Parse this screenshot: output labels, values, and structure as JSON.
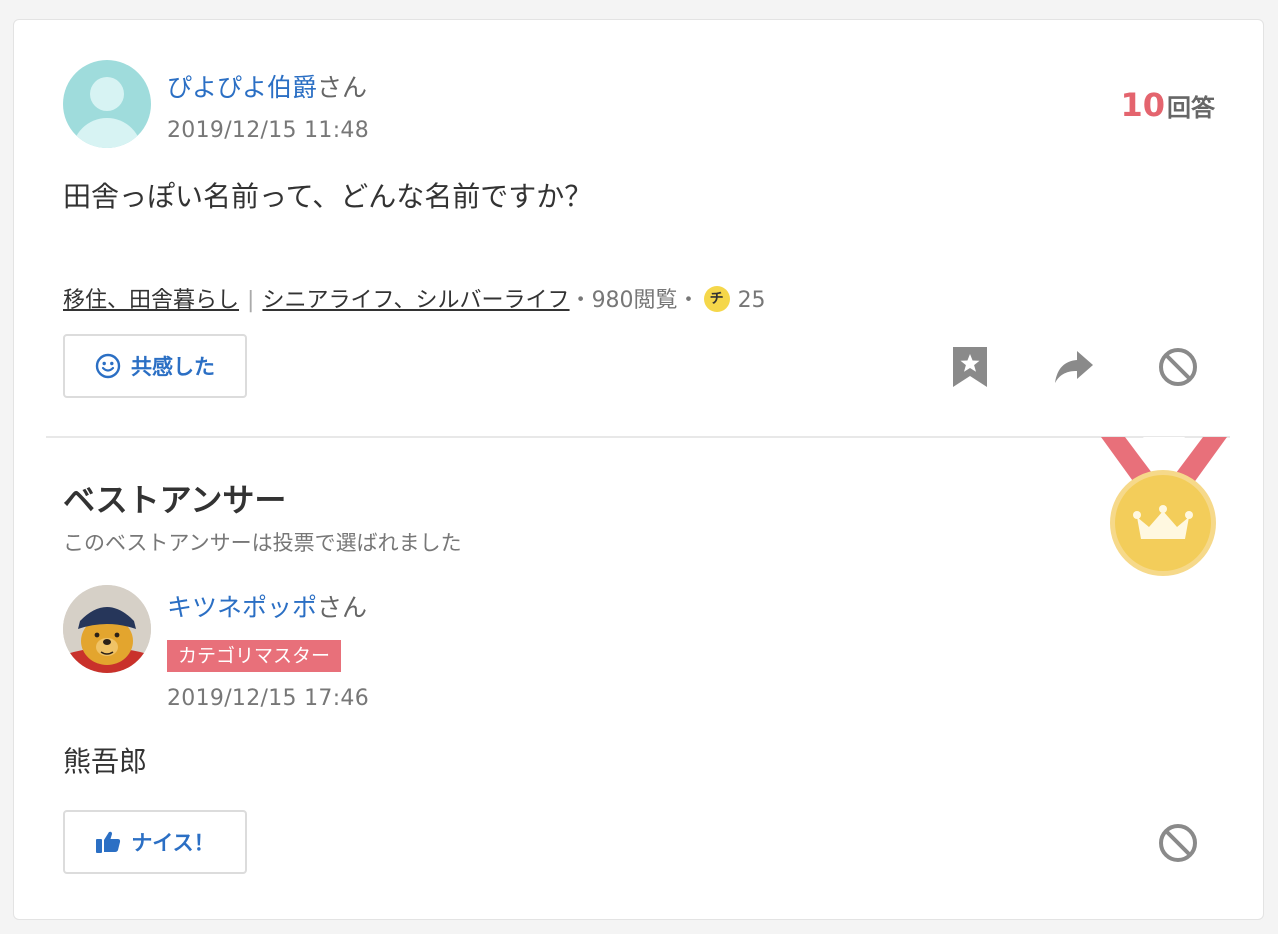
{
  "question": {
    "user_name": "ぴよぴよ伯爵",
    "user_suffix": "さん",
    "date": "2019/12/15 11:48",
    "answer_count": "10",
    "answer_count_label": "回答",
    "text": "田舎っぽい名前って、どんな名前ですか？",
    "category1": "移住、田舎暮らし",
    "category_separator": "|",
    "category2": "シニアライフ、シルバーライフ",
    "views": "・980閲覧・",
    "coin_label": "チ",
    "coins": "25",
    "empathy_button": "共感した"
  },
  "best_answer": {
    "title": "ベストアンサー",
    "subtitle": "このベストアンサーは投票で選ばれました",
    "user_name": "キツネポッポ",
    "user_suffix": "さん",
    "badge": "カテゴリマスター",
    "date": "2019/12/15 17:46",
    "text": "熊吾郎",
    "nice_button": "ナイス！"
  },
  "colors": {
    "link_blue": "#2b6fc4",
    "answer_count_red": "#e4646e",
    "badge_pink": "#e8707a",
    "medal_gold": "#f3cd5a",
    "ribbon_red": "#e8707a"
  },
  "icons": [
    "smile-icon",
    "bookmark-icon",
    "share-icon",
    "block-icon",
    "thumbs-up-icon",
    "medal-icon",
    "crown-icon",
    "coin-icon"
  ]
}
